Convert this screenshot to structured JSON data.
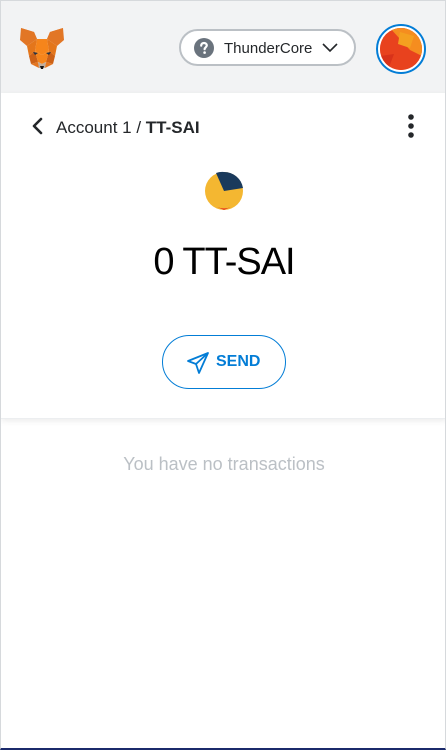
{
  "header": {
    "network_name": "ThunderCore",
    "logo_icon": "metamask-fox-icon",
    "network_icon": "question-circle-icon",
    "account_icon": "account-avatar-icon"
  },
  "asset": {
    "account_label": "Account 1",
    "separator": " / ",
    "token_symbol": "TT-SAI",
    "balance": "0 TT-SAI",
    "send_label": "SEND"
  },
  "transactions": {
    "empty_message": "You have no transactions"
  },
  "colors": {
    "accent": "#037dd6",
    "header_bg": "#f2f3f4",
    "muted_text": "#bbc0c5",
    "token_yellow": "#f4b731",
    "token_navy": "#1a3a5c"
  }
}
